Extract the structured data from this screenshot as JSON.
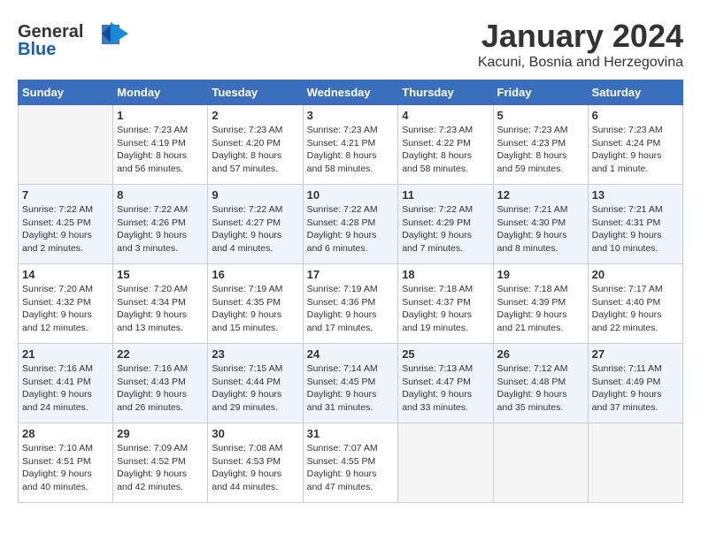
{
  "header": {
    "logo": {
      "general": "General",
      "blue": "Blue"
    },
    "title": "January 2024",
    "subtitle": "Kacuni, Bosnia and Herzegovina"
  },
  "calendar": {
    "days_of_week": [
      "Sunday",
      "Monday",
      "Tuesday",
      "Wednesday",
      "Thursday",
      "Friday",
      "Saturday"
    ],
    "weeks": [
      {
        "days": [
          {
            "num": "",
            "empty": true
          },
          {
            "num": "1",
            "sunrise": "7:23 AM",
            "sunset": "4:19 PM",
            "daylight": "8 hours and 56 minutes."
          },
          {
            "num": "2",
            "sunrise": "7:23 AM",
            "sunset": "4:20 PM",
            "daylight": "8 hours and 57 minutes."
          },
          {
            "num": "3",
            "sunrise": "7:23 AM",
            "sunset": "4:21 PM",
            "daylight": "8 hours and 58 minutes."
          },
          {
            "num": "4",
            "sunrise": "7:23 AM",
            "sunset": "4:22 PM",
            "daylight": "8 hours and 58 minutes."
          },
          {
            "num": "5",
            "sunrise": "7:23 AM",
            "sunset": "4:23 PM",
            "daylight": "8 hours and 59 minutes."
          },
          {
            "num": "6",
            "sunrise": "7:23 AM",
            "sunset": "4:24 PM",
            "daylight": "9 hours and 1 minute."
          }
        ]
      },
      {
        "days": [
          {
            "num": "7",
            "sunrise": "7:22 AM",
            "sunset": "4:25 PM",
            "daylight": "9 hours and 2 minutes."
          },
          {
            "num": "8",
            "sunrise": "7:22 AM",
            "sunset": "4:26 PM",
            "daylight": "9 hours and 3 minutes."
          },
          {
            "num": "9",
            "sunrise": "7:22 AM",
            "sunset": "4:27 PM",
            "daylight": "9 hours and 4 minutes."
          },
          {
            "num": "10",
            "sunrise": "7:22 AM",
            "sunset": "4:28 PM",
            "daylight": "9 hours and 6 minutes."
          },
          {
            "num": "11",
            "sunrise": "7:22 AM",
            "sunset": "4:29 PM",
            "daylight": "9 hours and 7 minutes."
          },
          {
            "num": "12",
            "sunrise": "7:21 AM",
            "sunset": "4:30 PM",
            "daylight": "9 hours and 8 minutes."
          },
          {
            "num": "13",
            "sunrise": "7:21 AM",
            "sunset": "4:31 PM",
            "daylight": "9 hours and 10 minutes."
          }
        ]
      },
      {
        "days": [
          {
            "num": "14",
            "sunrise": "7:20 AM",
            "sunset": "4:32 PM",
            "daylight": "9 hours and 12 minutes."
          },
          {
            "num": "15",
            "sunrise": "7:20 AM",
            "sunset": "4:34 PM",
            "daylight": "9 hours and 13 minutes."
          },
          {
            "num": "16",
            "sunrise": "7:19 AM",
            "sunset": "4:35 PM",
            "daylight": "9 hours and 15 minutes."
          },
          {
            "num": "17",
            "sunrise": "7:19 AM",
            "sunset": "4:36 PM",
            "daylight": "9 hours and 17 minutes."
          },
          {
            "num": "18",
            "sunrise": "7:18 AM",
            "sunset": "4:37 PM",
            "daylight": "9 hours and 19 minutes."
          },
          {
            "num": "19",
            "sunrise": "7:18 AM",
            "sunset": "4:39 PM",
            "daylight": "9 hours and 21 minutes."
          },
          {
            "num": "20",
            "sunrise": "7:17 AM",
            "sunset": "4:40 PM",
            "daylight": "9 hours and 22 minutes."
          }
        ]
      },
      {
        "days": [
          {
            "num": "21",
            "sunrise": "7:16 AM",
            "sunset": "4:41 PM",
            "daylight": "9 hours and 24 minutes."
          },
          {
            "num": "22",
            "sunrise": "7:16 AM",
            "sunset": "4:43 PM",
            "daylight": "9 hours and 26 minutes."
          },
          {
            "num": "23",
            "sunrise": "7:15 AM",
            "sunset": "4:44 PM",
            "daylight": "9 hours and 29 minutes."
          },
          {
            "num": "24",
            "sunrise": "7:14 AM",
            "sunset": "4:45 PM",
            "daylight": "9 hours and 31 minutes."
          },
          {
            "num": "25",
            "sunrise": "7:13 AM",
            "sunset": "4:47 PM",
            "daylight": "9 hours and 33 minutes."
          },
          {
            "num": "26",
            "sunrise": "7:12 AM",
            "sunset": "4:48 PM",
            "daylight": "9 hours and 35 minutes."
          },
          {
            "num": "27",
            "sunrise": "7:11 AM",
            "sunset": "4:49 PM",
            "daylight": "9 hours and 37 minutes."
          }
        ]
      },
      {
        "days": [
          {
            "num": "28",
            "sunrise": "7:10 AM",
            "sunset": "4:51 PM",
            "daylight": "9 hours and 40 minutes."
          },
          {
            "num": "29",
            "sunrise": "7:09 AM",
            "sunset": "4:52 PM",
            "daylight": "9 hours and 42 minutes."
          },
          {
            "num": "30",
            "sunrise": "7:08 AM",
            "sunset": "4:53 PM",
            "daylight": "9 hours and 44 minutes."
          },
          {
            "num": "31",
            "sunrise": "7:07 AM",
            "sunset": "4:55 PM",
            "daylight": "9 hours and 47 minutes."
          },
          {
            "num": "",
            "empty": true
          },
          {
            "num": "",
            "empty": true
          },
          {
            "num": "",
            "empty": true
          }
        ]
      }
    ]
  },
  "labels": {
    "sunrise": "Sunrise:",
    "sunset": "Sunset:",
    "daylight": "Daylight:"
  }
}
